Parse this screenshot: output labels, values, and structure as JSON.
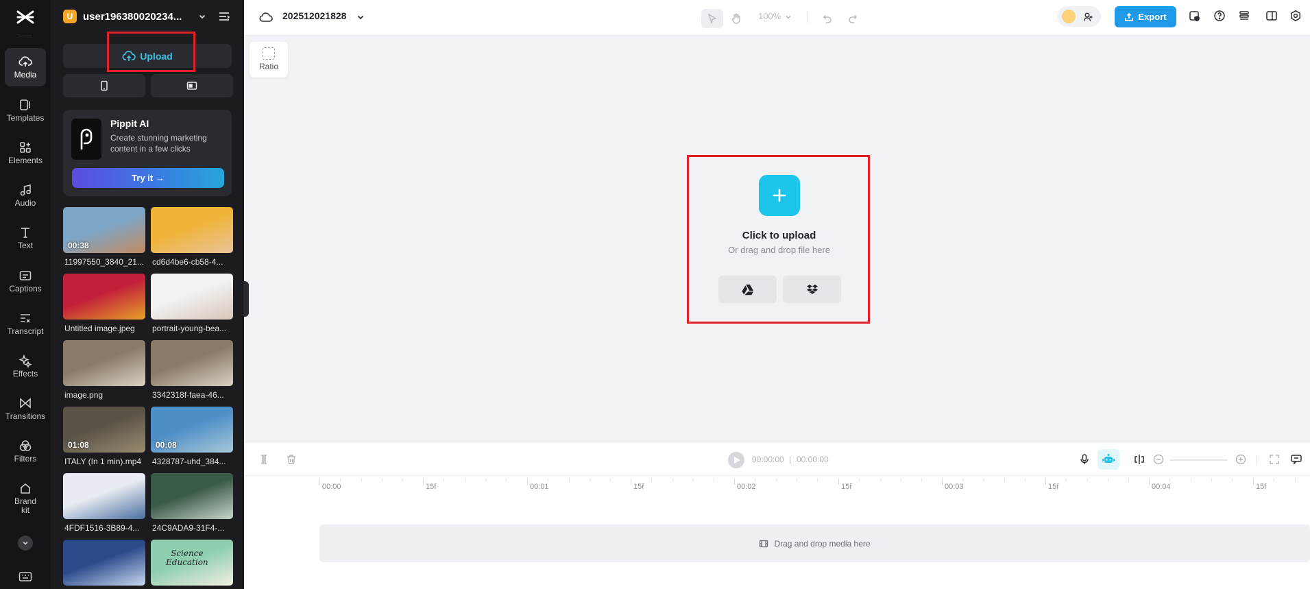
{
  "rail": {
    "items": [
      {
        "label": "Media",
        "icon": "cloud-upload-icon"
      },
      {
        "label": "Templates",
        "icon": "templates-icon"
      },
      {
        "label": "Elements",
        "icon": "elements-icon"
      },
      {
        "label": "Audio",
        "icon": "music-note-icon"
      },
      {
        "label": "Text",
        "icon": "text-icon"
      },
      {
        "label": "Captions",
        "icon": "captions-icon"
      },
      {
        "label": "Transcript",
        "icon": "transcript-icon"
      },
      {
        "label": "Effects",
        "icon": "sparkle-icon"
      },
      {
        "label": "Transitions",
        "icon": "transitions-icon"
      },
      {
        "label": "Filters",
        "icon": "filters-icon"
      },
      {
        "label": "Brand\nkit",
        "icon": "brand-kit-icon"
      }
    ]
  },
  "panel": {
    "account_badge": "U",
    "account_name": "user196380020234...",
    "upload_label": "Upload",
    "promo": {
      "title": "Pippit AI",
      "description": "Create stunning marketing content in a few clicks",
      "cta": "Try it →"
    },
    "media": [
      {
        "name": "11997550_3840_21...",
        "duration": "00:38",
        "colors": [
          "#7ba6c8",
          "#c48a60"
        ]
      },
      {
        "name": "cd6d4be6-cb58-4...",
        "duration": "",
        "colors": [
          "#f0b43a",
          "#e8c49a"
        ]
      },
      {
        "name": "Untitled image.jpeg",
        "duration": "",
        "colors": [
          "#c21f3a",
          "#e6a028"
        ]
      },
      {
        "name": "portrait-young-bea...",
        "duration": "",
        "colors": [
          "#f2f2f2",
          "#d8c6b8"
        ]
      },
      {
        "name": "image.png",
        "duration": "",
        "colors": [
          "#8a7a66",
          "#d9d2c6"
        ]
      },
      {
        "name": "3342318f-faea-46...",
        "duration": "",
        "colors": [
          "#8a7a66",
          "#d9d2c6"
        ]
      },
      {
        "name": "ITALY (In 1 min).mp4",
        "duration": "01:08",
        "colors": [
          "#5a5448",
          "#9a8c70"
        ]
      },
      {
        "name": "4328787-uhd_384...",
        "duration": "00:08",
        "colors": [
          "#4f8fc8",
          "#a8c8d8"
        ]
      },
      {
        "name": "4FDF1516-3B89-4...",
        "duration": "",
        "colors": [
          "#e8ecf2",
          "#4a6fa0"
        ]
      },
      {
        "name": "24C9ADA9-31F4-...",
        "duration": "",
        "colors": [
          "#3a5a48",
          "#c9d6cc"
        ]
      },
      {
        "name": "",
        "duration": "",
        "colors": [
          "#2a4a8a",
          "#c8d8f0"
        ]
      },
      {
        "name": "",
        "duration": "",
        "colors": [
          "#8fcfb0",
          "#f2eee0"
        ],
        "overlay": "Science\nEducation"
      }
    ]
  },
  "topbar": {
    "project_name": "202512021828",
    "zoom": "100%",
    "export_label": "Export"
  },
  "canvas": {
    "ratio_label": "Ratio",
    "upload_title": "Click to upload",
    "upload_subtitle": "Or drag and drop file here"
  },
  "timeline": {
    "current_time": "00:00:00",
    "total_time": "00:00:00",
    "ruler": [
      "00:00",
      "15f",
      "00:01",
      "15f",
      "00:02",
      "15f",
      "00:03",
      "15f",
      "00:04",
      "15f"
    ],
    "drop_hint": "Drag and drop media here"
  }
}
